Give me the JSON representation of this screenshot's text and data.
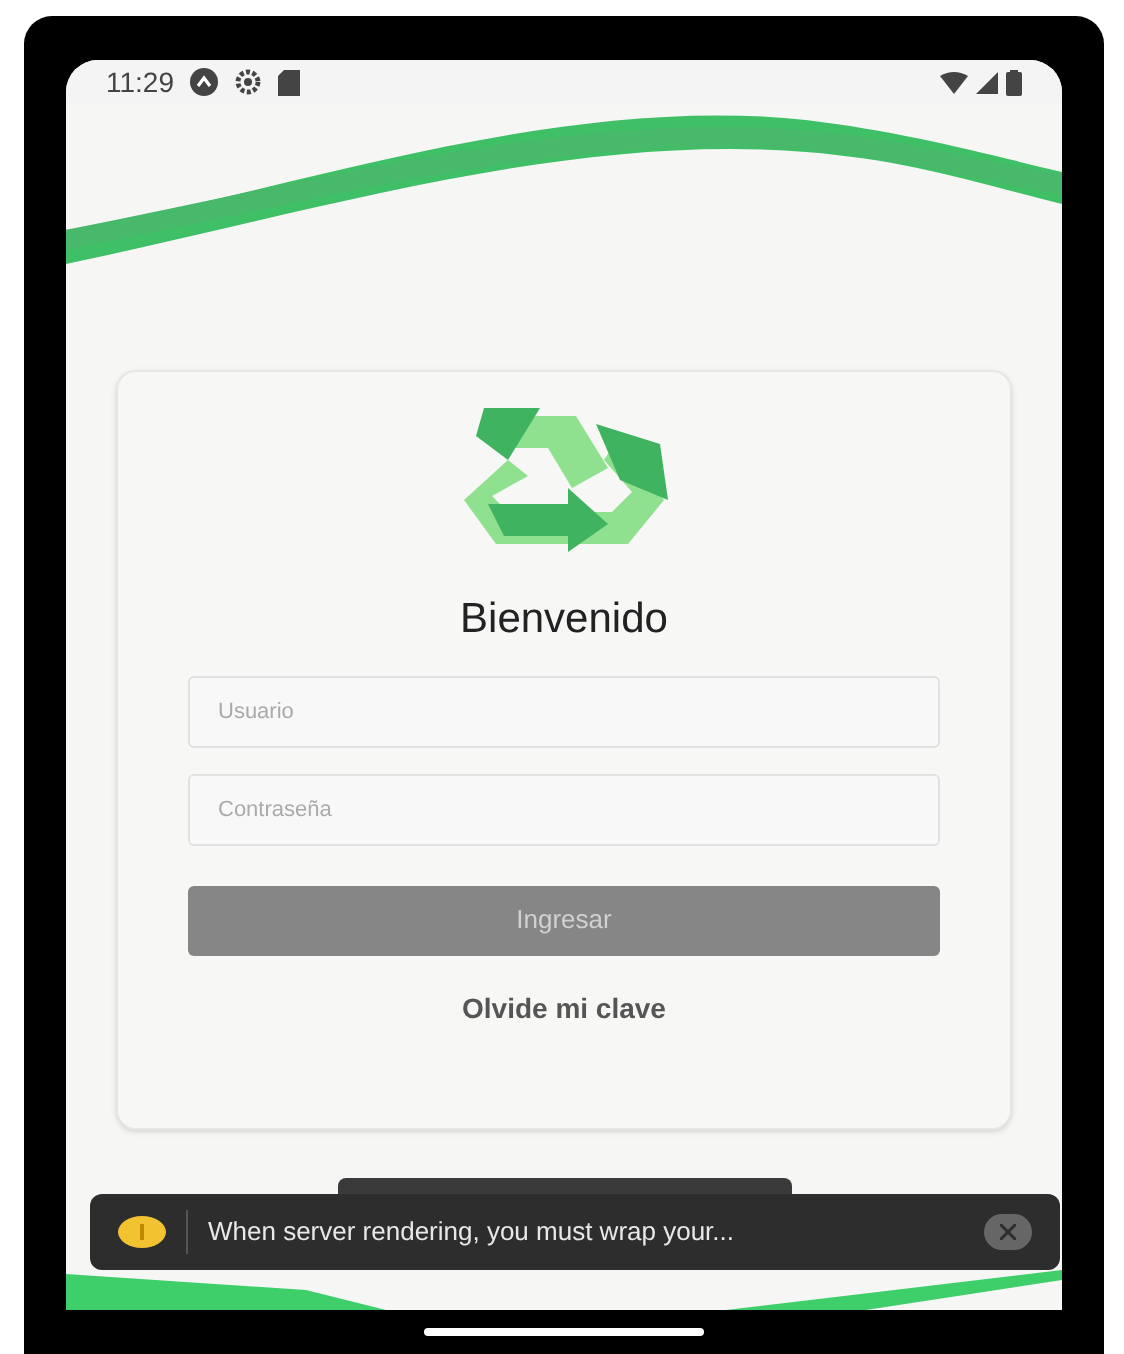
{
  "status_bar": {
    "time": "11:29"
  },
  "login": {
    "title": "Bienvenido",
    "fields": [
      {
        "placeholder": "Usuario"
      },
      {
        "placeholder": "Contraseña"
      }
    ],
    "submit": {
      "label": "Ingresar",
      "disabled": true
    },
    "forgot_link": "Olvide mi clave"
  },
  "toast": {
    "message": "When server rendering, you must wrap your..."
  }
}
